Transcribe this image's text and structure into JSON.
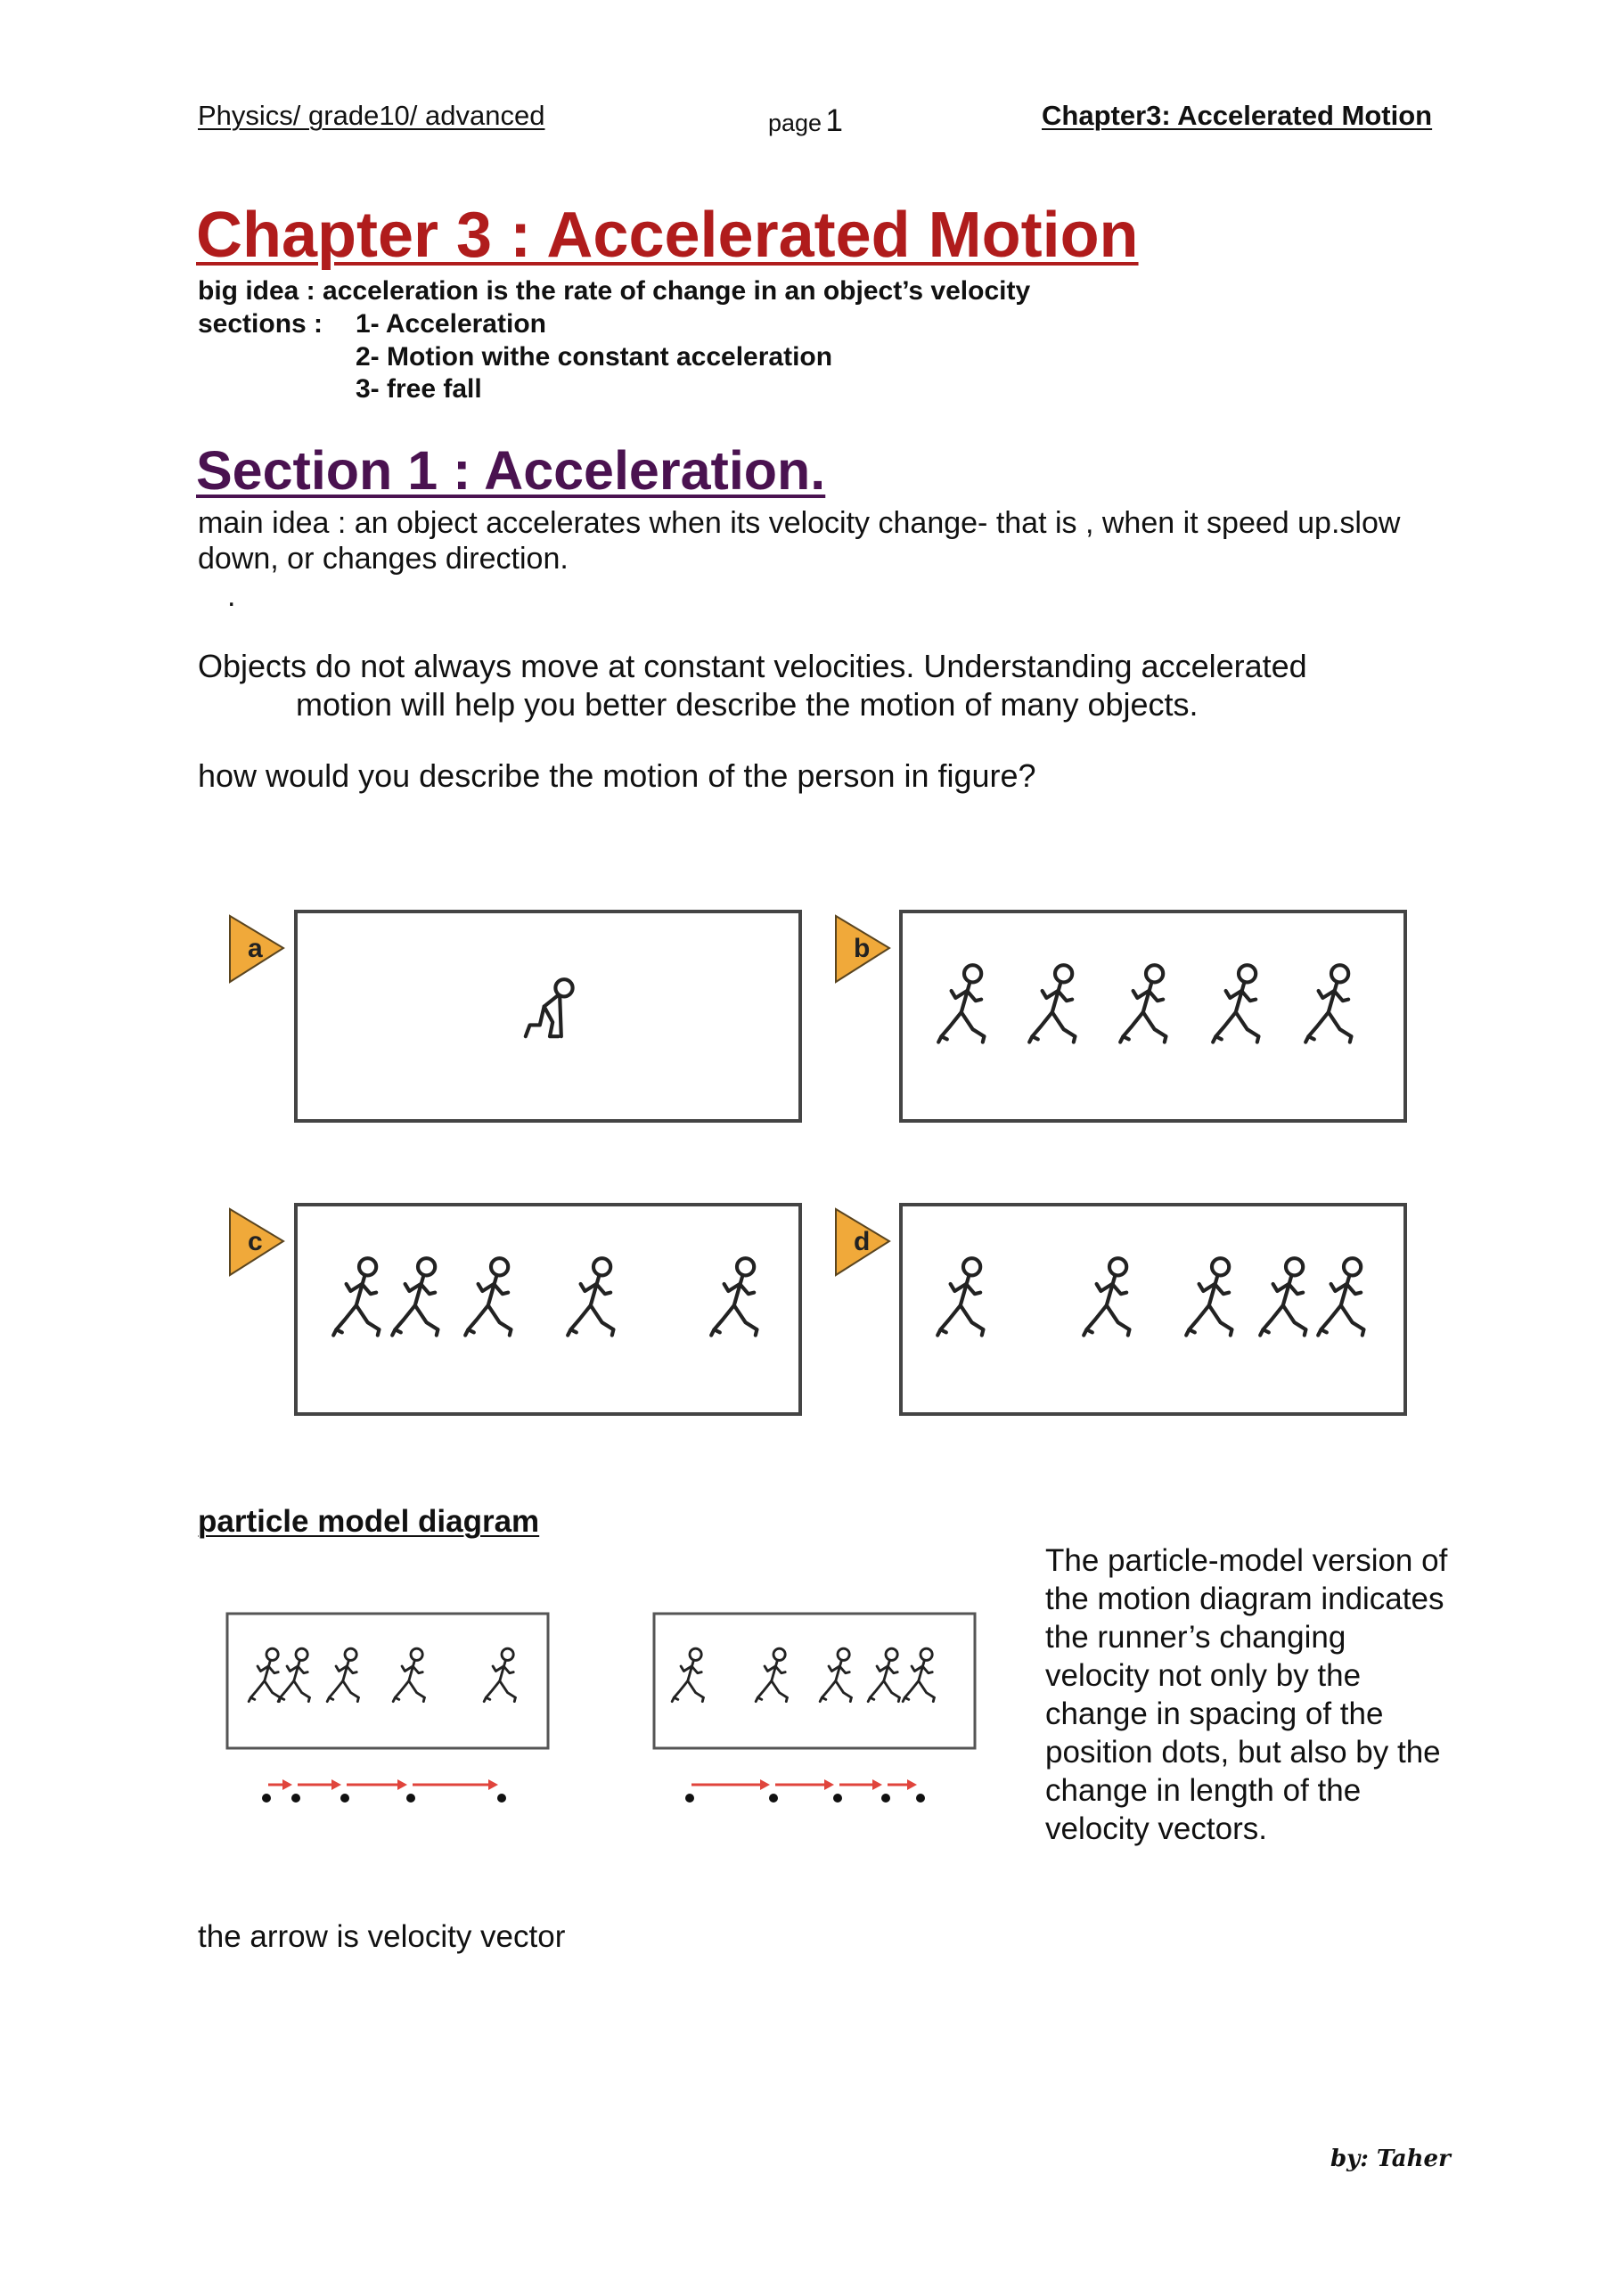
{
  "header": {
    "left": "Physics/ grade10/ advanced",
    "page_label": "page",
    "page_number": "1",
    "right": "Chapter3: Accelerated Motion"
  },
  "chapter": {
    "title": "Chapter 3 : Accelerated Motion",
    "big_idea": "big idea : acceleration is the rate of change in an object’s velocity",
    "sections_label": "sections   :",
    "sections": [
      "1- Acceleration",
      "2- Motion withe constant acceleration",
      "3- free fall"
    ]
  },
  "section1": {
    "title": "Section 1 : Acceleration.",
    "main_idea_line1": "main idea : an object accelerates when its velocity change- that is , when it speed up.slow",
    "main_idea_line2": "down, or changes direction.",
    "dot": ".",
    "para_line1": "Objects do not always move at constant velocities. Understanding accelerated",
    "para_line2": "motion will help you better describe the motion of many objects.",
    "question": "how would you describe the motion of the person in figure?"
  },
  "figure": {
    "label_color": "#f0a93a",
    "panels": [
      {
        "label": "a",
        "runners": 1,
        "pose": "crouch"
      },
      {
        "label": "b",
        "runners": 5,
        "spacing": "constant"
      },
      {
        "label": "c",
        "runners": 5,
        "spacing": "increasing"
      },
      {
        "label": "d",
        "runners": 5,
        "spacing": "decreasing"
      }
    ]
  },
  "particle_model": {
    "heading": "particle model diagram",
    "vector_color": "#e0443c",
    "diagrams": [
      {
        "trend": "speeding up",
        "dots": 5
      },
      {
        "trend": "slowing down",
        "dots": 5
      }
    ],
    "description": "The particle-model version of the motion diagram indicates the runner’s changing velocity not only by the change in spacing of the position dots, but also by the change in length of the velocity vectors.",
    "caption": "the arrow is velocity vector"
  },
  "signature": "by: Taher"
}
